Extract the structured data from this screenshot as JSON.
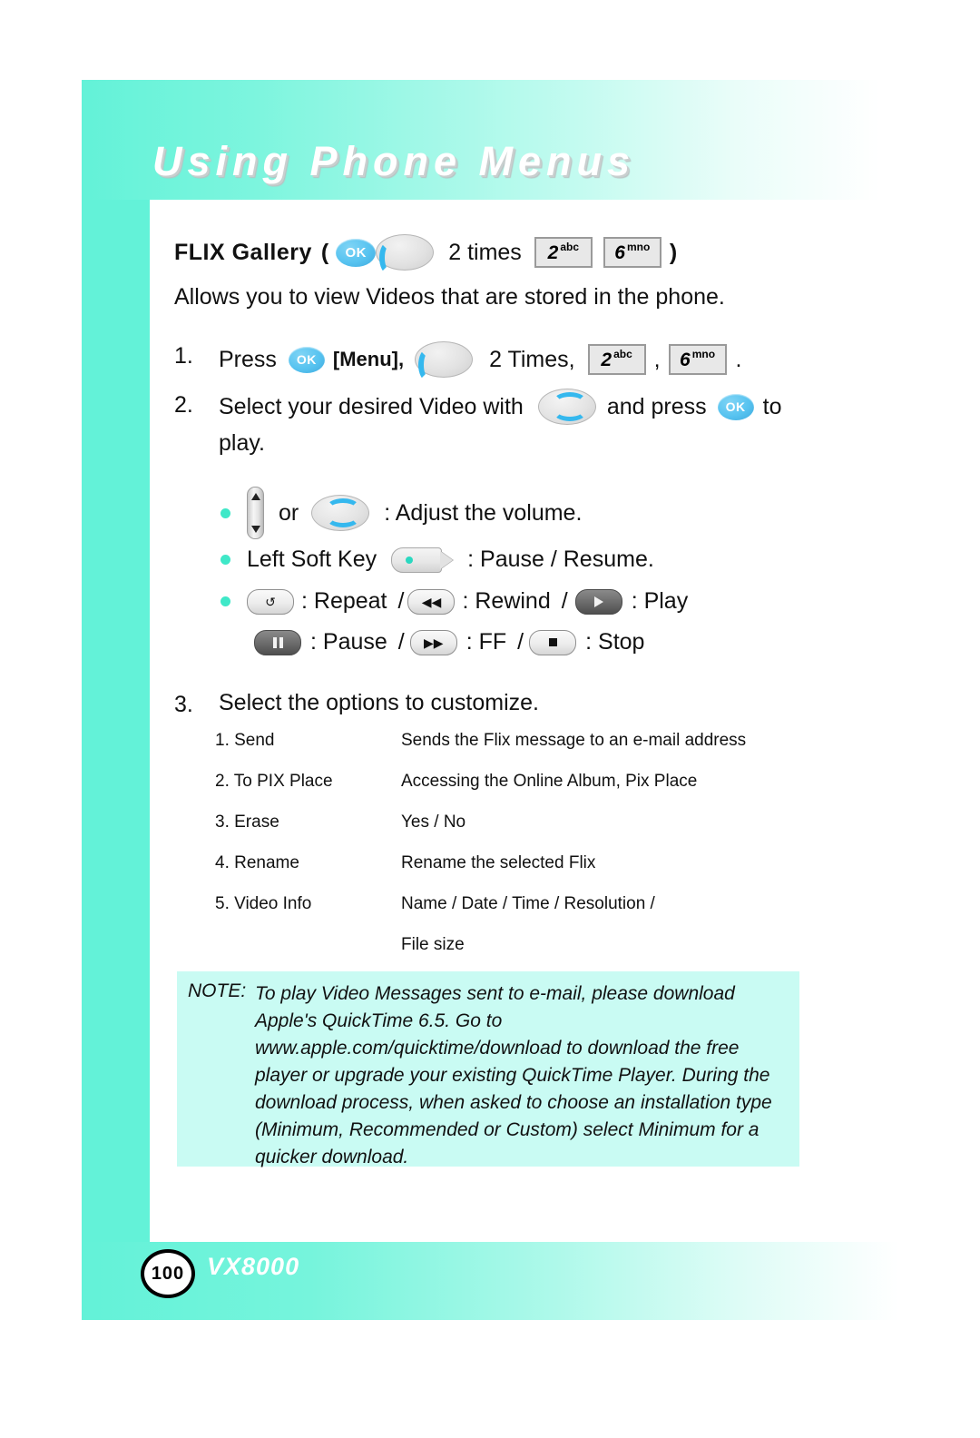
{
  "header": {
    "title": "Using Phone Menus"
  },
  "section": {
    "heading_label": "FLIX Gallery",
    "heading_paren_open": "(",
    "heading_ok_key": "OK",
    "heading_times": "2 times",
    "heading_key2_num": "2",
    "heading_key2_letters": "abc",
    "heading_key6_num": "6",
    "heading_key6_letters": "mno",
    "heading_paren_close": ")",
    "intro": "Allows you to view Videos that are stored in the phone."
  },
  "steps": {
    "one": {
      "num": "1.",
      "press": "Press",
      "ok_key": "OK",
      "menu": "[Menu],",
      "times": "2 Times,",
      "key2_num": "2",
      "key2_letters": "abc",
      "comma": ",",
      "key6_num": "6",
      "key6_letters": "mno",
      "period": "."
    },
    "two": {
      "num": "2.",
      "text_a": "Select your desired Video with",
      "text_b": "and press",
      "ok_key": "OK",
      "text_c": "to",
      "text_d": "play."
    },
    "three": {
      "num": "3.",
      "text": "Select the options to customize."
    }
  },
  "bullets": {
    "volume": {
      "or": "or",
      "text": ": Adjust the volume."
    },
    "softkey": {
      "label": "Left Soft Key",
      "text": ": Pause / Resume."
    },
    "playback_row1": {
      "repeat": ": Repeat",
      "slash1": "/",
      "rewind": ": Rewind",
      "slash2": "/",
      "play": ": Play"
    },
    "playback_row2": {
      "pause": ": Pause",
      "slash1": "/",
      "ff": ": FF",
      "slash2": "/",
      "stop": ": Stop"
    }
  },
  "options_table": {
    "rows": [
      {
        "key": "1. Send",
        "value": "Sends the Flix message to an e-mail address"
      },
      {
        "key": "2. To PIX Place",
        "value": "Accessing the Online Album, Pix Place"
      },
      {
        "key": "3. Erase",
        "value": "Yes / No"
      },
      {
        "key": "4. Rename",
        "value": "Rename the selected Flix"
      },
      {
        "key": "5. Video Info",
        "value": "Name / Date / Time / Resolution /"
      },
      {
        "key": "",
        "value": "File size"
      }
    ]
  },
  "note": {
    "label": "NOTE:",
    "text": "To play Video Messages sent to e-mail, please download Apple's QuickTime 6.5.  Go to www.apple.com/quicktime/download to download the free player or upgrade your existing QuickTime Player. During the download process, when asked to choose an installation type (Minimum, Recommended or Custom) select Minimum for a quicker download."
  },
  "footer": {
    "page_number": "100",
    "model": "VX8000"
  },
  "colors": {
    "teal": "#63f2d8",
    "note_bg": "#c9fbf3",
    "ok_blue": "#57c3f0",
    "bullet": "#3fe8c8"
  }
}
